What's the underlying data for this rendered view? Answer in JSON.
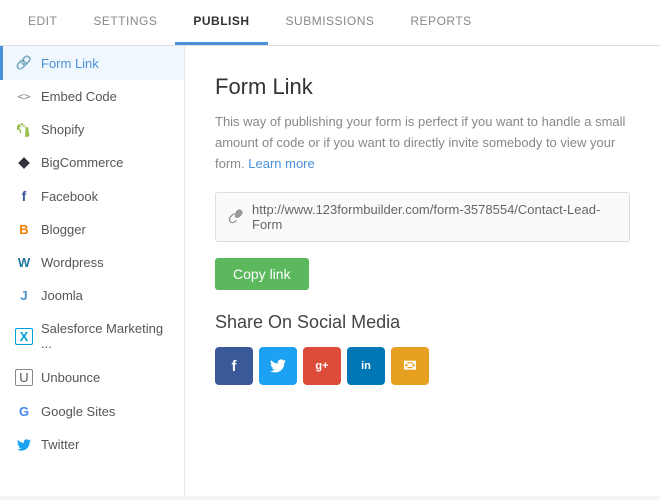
{
  "nav": {
    "items": [
      {
        "id": "edit",
        "label": "EDIT",
        "active": false
      },
      {
        "id": "settings",
        "label": "SETTINGS",
        "active": false
      },
      {
        "id": "publish",
        "label": "PUBLISH",
        "active": true
      },
      {
        "id": "submissions",
        "label": "SUBMISSIONS",
        "active": false
      },
      {
        "id": "reports",
        "label": "REPORTS",
        "active": false
      }
    ]
  },
  "sidebar": {
    "items": [
      {
        "id": "form-link",
        "label": "Form Link",
        "icon": "🔗",
        "active": true
      },
      {
        "id": "embed-code",
        "label": "Embed Code",
        "icon": "<>",
        "active": false
      },
      {
        "id": "shopify",
        "label": "Shopify",
        "icon": "🛍",
        "active": false
      },
      {
        "id": "bigcommerce",
        "label": "BigCommerce",
        "icon": "📊",
        "active": false
      },
      {
        "id": "facebook",
        "label": "Facebook",
        "icon": "f",
        "active": false
      },
      {
        "id": "blogger",
        "label": "Blogger",
        "icon": "B",
        "active": false
      },
      {
        "id": "wordpress",
        "label": "Wordpress",
        "icon": "W",
        "active": false
      },
      {
        "id": "joomla",
        "label": "Joomla",
        "icon": "J",
        "active": false
      },
      {
        "id": "salesforce",
        "label": "Salesforce Marketing ...",
        "icon": "X",
        "active": false
      },
      {
        "id": "unbounce",
        "label": "Unbounce",
        "icon": "U",
        "active": false
      },
      {
        "id": "google-sites",
        "label": "Google Sites",
        "icon": "G",
        "active": false
      },
      {
        "id": "twitter",
        "label": "Twitter",
        "icon": "t",
        "active": false
      }
    ]
  },
  "content": {
    "title": "Form Link",
    "description": "This way of publishing your form is perfect if you want to handle a small amount of code or if you want to directly invite somebody to view your form.",
    "learn_more": "Learn more",
    "link_url": "http://www.123formbuilder.com/form-3578554/Contact-Lead-Form",
    "copy_button_label": "Copy link",
    "share_title": "Share On Social Media",
    "social_buttons": [
      {
        "id": "facebook",
        "label": "f",
        "color": "#3b5998"
      },
      {
        "id": "twitter",
        "label": "t",
        "color": "#1da1f2"
      },
      {
        "id": "google-plus",
        "label": "g+",
        "color": "#dd4b39"
      },
      {
        "id": "linkedin",
        "label": "in",
        "color": "#0077b5"
      },
      {
        "id": "email",
        "label": "✉",
        "color": "#e8a020"
      }
    ]
  }
}
